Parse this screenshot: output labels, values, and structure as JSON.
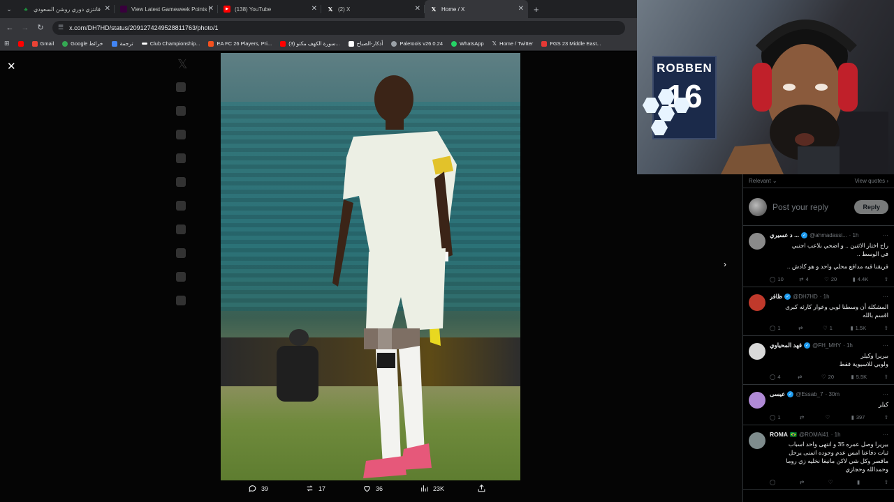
{
  "browser": {
    "tabs": [
      {
        "title": "فانتزي دوري روشن السعودي",
        "icon": "leaf-icon",
        "color": "#1e8e3e"
      },
      {
        "title": "View Latest Gameweek Points |",
        "icon": "fpl-icon",
        "color": "#38003c"
      },
      {
        "title": "(138) YouTube",
        "icon": "youtube-icon",
        "color": "#ff0000"
      },
      {
        "title": "(2) X",
        "icon": "x-icon",
        "color": "#000000"
      },
      {
        "title": "Home / X",
        "icon": "x-icon",
        "color": "#000000"
      }
    ],
    "url": "x.com/DH7HD/status/2091274249528811763/photo/1",
    "bookmarks": [
      {
        "label": "",
        "icon": "youtube-icon",
        "color": "#ff0000"
      },
      {
        "label": "Gmail",
        "icon": "gmail-icon",
        "color": "#ea4335"
      },
      {
        "label": "Google خرائط",
        "icon": "maps-icon",
        "color": "#34a853"
      },
      {
        "label": "ترجمة",
        "icon": "translate-icon",
        "color": "#4285f4"
      },
      {
        "label": "Club Championship...",
        "icon": "ea-icon",
        "color": "#ffffff"
      },
      {
        "label": "EA FC 26 Players, Pri...",
        "icon": "futbin-icon",
        "color": "#f4511e"
      },
      {
        "label": "(3) سورة الكهف مكتو...",
        "icon": "youtube-icon",
        "color": "#ff0000"
      },
      {
        "label": "أذكار-الصباح",
        "icon": "doc-icon",
        "color": "#ffffff"
      },
      {
        "label": "Paletools v26.0.24",
        "icon": "paletools-icon",
        "color": "#9aa0a6"
      },
      {
        "label": "WhatsApp",
        "icon": "whatsapp-icon",
        "color": "#25d366"
      },
      {
        "label": "Home / Twitter",
        "icon": "x-icon",
        "color": "#ffffff"
      },
      {
        "label": "FGS 23 Middle East...",
        "icon": "fgs-icon",
        "color": "#e53935"
      }
    ]
  },
  "photo_actions": {
    "replies": "39",
    "reposts": "17",
    "likes": "36",
    "views": "23K"
  },
  "replies_panel": {
    "sort_label": "Relevant",
    "quotes_label": "View quotes",
    "compose_placeholder": "Post your reply",
    "reply_button": "Reply",
    "replies": [
      {
        "name": "د عسيري ...",
        "handle": "@ahmadassi...",
        "time": "· 1h",
        "text_lines": [
          "راح اختار الاثنين .. و اضحي بلاعب اجنبي",
          "في الوسط ..",
          "",
          "فريقنا فيه مدافع محلي واحد و هو كادش .."
        ],
        "stats": {
          "replies": "10",
          "reposts": "4",
          "likes": "20",
          "views": "4.4K"
        },
        "avatar_color": "#8a8a8a"
      },
      {
        "name": "ظافر",
        "handle": "@DH7HD",
        "time": "· 1h",
        "text_lines": [
          "المشكلة أن وسطنا لوبي وعوار كارثه كبرى",
          "اقسم بالله"
        ],
        "stats": {
          "replies": "1",
          "reposts": "",
          "likes": "1",
          "views": "1.5K"
        },
        "avatar_color": "#c0392b"
      },
      {
        "name": "فهد المحياوي",
        "handle": "@FH_MHY",
        "time": "· 1h",
        "text_lines": [
          "بيريرا وكيلر",
          "ولوبي للاسيوية فقط"
        ],
        "stats": {
          "replies": "4",
          "reposts": "",
          "likes": "20",
          "views": "5.5K"
        },
        "avatar_color": "#d9d9d9"
      },
      {
        "name": "عيسى",
        "handle": "@Essab_7",
        "time": "· 30m",
        "text_lines": [
          "كيلر"
        ],
        "stats": {
          "replies": "1",
          "reposts": "",
          "likes": "",
          "views": "397"
        },
        "avatar_color": "#b08ad6"
      },
      {
        "name": "ROMA",
        "handle": "@ROMAi41",
        "time": "· 1h",
        "text_lines": [
          "بيريرا وصل عمره 35 و انتهى واحد اسباب",
          "ثبات دفاعنا امس عدم وجوده اتمنى يرحل",
          "ماقصر وكل شي لاكن مانبغا نخليه زي روما",
          "وحمدالله وحجازي"
        ],
        "stats": {
          "replies": "",
          "reposts": "",
          "likes": "",
          "views": ""
        },
        "avatar_color": "#7f8c8d",
        "badge": "🇧🇷"
      }
    ]
  },
  "webcam": {
    "poster_name": "ROBBEN",
    "poster_number": "16"
  }
}
